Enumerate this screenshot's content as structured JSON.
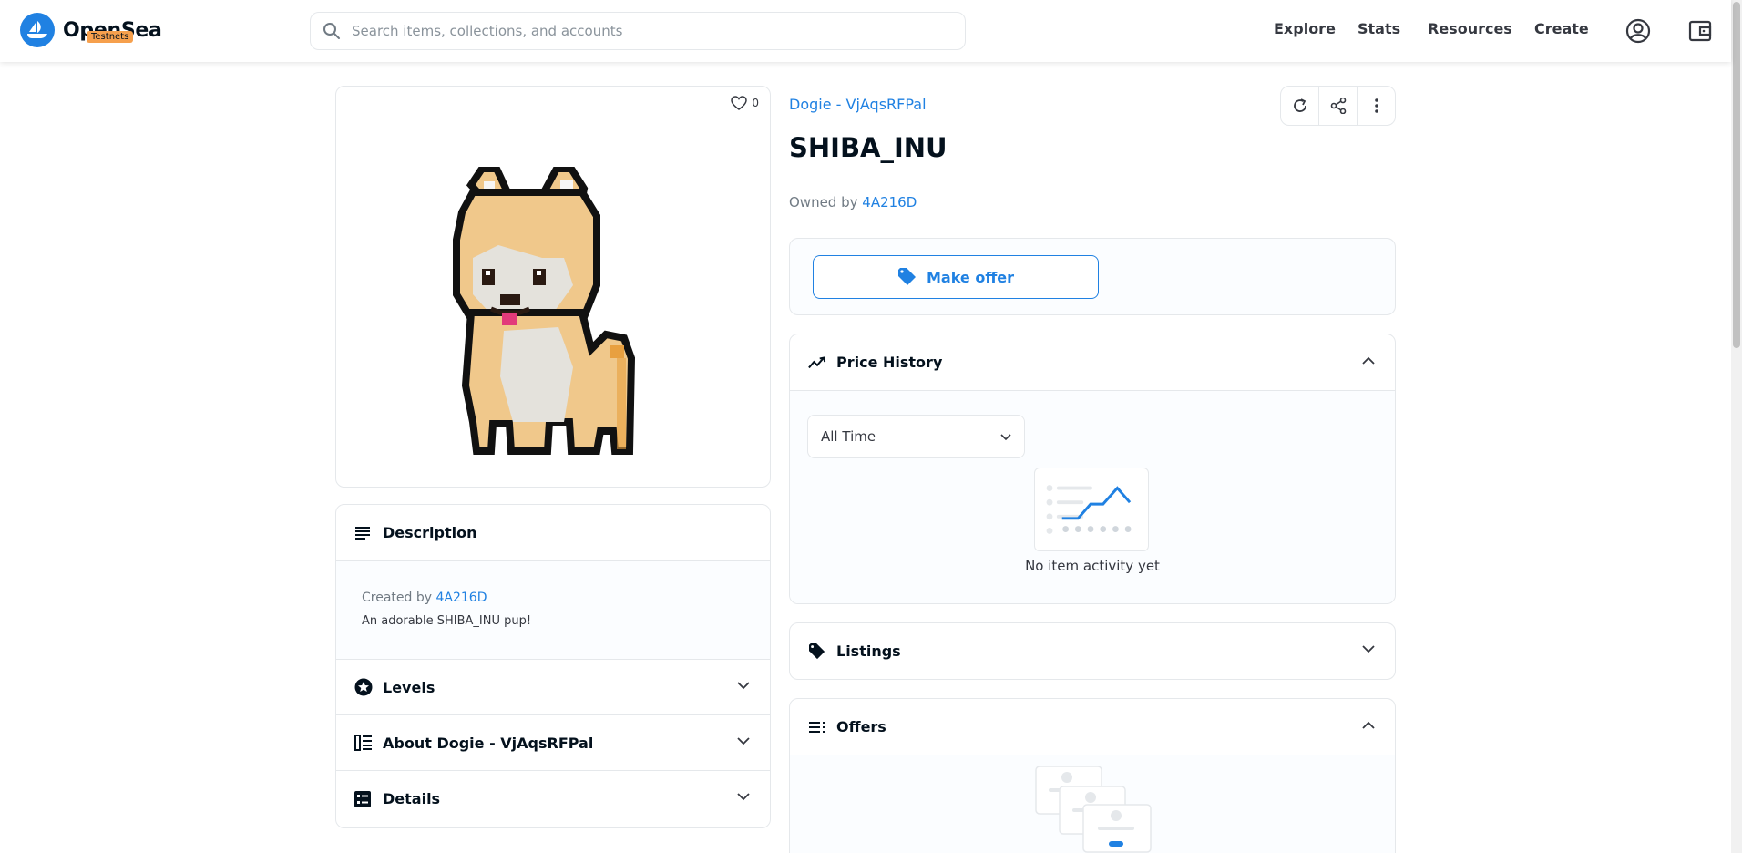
{
  "header": {
    "logo_text": "OpenSea",
    "badge": "Testnets",
    "search_placeholder": "Search items, collections, and accounts",
    "nav": [
      "Explore",
      "Stats",
      "Resources",
      "Create"
    ]
  },
  "item": {
    "collection": "Dogie - VjAqsRFPal",
    "title": "SHIBA_INU",
    "owned_by_label": "Owned by",
    "owner": "4A216D",
    "favorites": "0"
  },
  "description": {
    "heading": "Description",
    "created_by_label": "Created by",
    "creator": "4A216D",
    "text": "An adorable SHIBA_INU pup!"
  },
  "accordions": {
    "levels": "Levels",
    "about": "About Dogie - VjAqsRFPal",
    "details": "Details"
  },
  "offer": {
    "button": "Make offer"
  },
  "price_history": {
    "heading": "Price History",
    "time_filter": "All Time",
    "empty": "No item activity yet"
  },
  "listings": {
    "heading": "Listings"
  },
  "offers": {
    "heading": "Offers"
  },
  "colors": {
    "accent": "#2081e2",
    "badge": "#f6a04d",
    "text": "#04111d",
    "muted": "#707a83",
    "border": "#e5e8eb"
  }
}
